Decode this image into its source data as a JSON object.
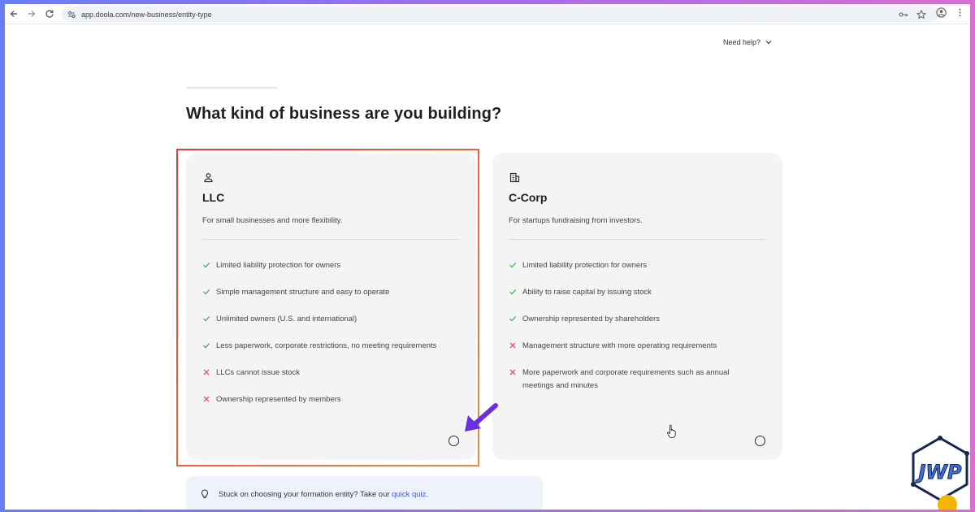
{
  "browser": {
    "url": "app.doola.com/new-business/entity-type"
  },
  "header": {
    "help_label": "Need help?"
  },
  "page": {
    "title": "What kind of business are you building?"
  },
  "cards": [
    {
      "icon": "person-icon",
      "title": "LLC",
      "subtitle": "For small businesses and more flexibility.",
      "features": [
        {
          "type": "pro",
          "text": "Limited liability protection for owners"
        },
        {
          "type": "pro",
          "text": "Simple management structure and easy to operate"
        },
        {
          "type": "pro",
          "text": "Unlimited owners (U.S. and international)"
        },
        {
          "type": "pro",
          "text": "Less paperwork, corporate restrictions, no meeting requirements"
        },
        {
          "type": "con",
          "text": "LLCs cannot issue stock"
        },
        {
          "type": "con",
          "text": "Ownership represented by members"
        }
      ]
    },
    {
      "icon": "building-icon",
      "title": "C-Corp",
      "subtitle": "For startups fundraising from investors.",
      "features": [
        {
          "type": "pro",
          "text": "Limited liability protection for owners"
        },
        {
          "type": "pro",
          "text": "Ability to raise capital by issuing stock"
        },
        {
          "type": "pro",
          "text": "Ownership represented by shareholders"
        },
        {
          "type": "con",
          "text": "Management structure with more operating requirements"
        },
        {
          "type": "con",
          "text": "More paperwork and corporate requirements such as annual meetings and minutes"
        }
      ]
    }
  ],
  "quiz": {
    "text": "Stuck on choosing your formation entity? Take our ",
    "link": "quick quiz",
    "suffix": "."
  },
  "watermark": {
    "text": "JWP"
  },
  "colors": {
    "check": "#4caf50",
    "cross": "#e0525a",
    "highlight": "#e8643a",
    "arrow": "#6a2fe0",
    "link": "#3b5bd9"
  }
}
